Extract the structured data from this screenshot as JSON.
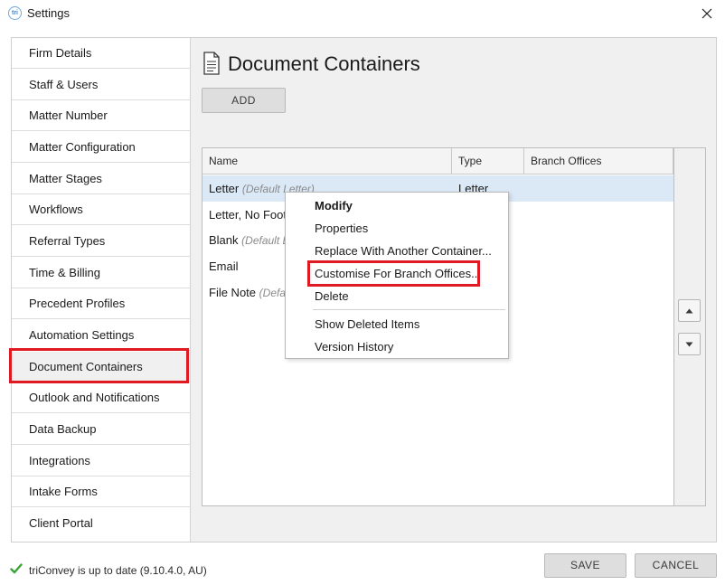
{
  "window": {
    "title": "Settings",
    "app_icon_text": "tri"
  },
  "sidebar": {
    "items": [
      {
        "label": "Firm Details"
      },
      {
        "label": "Staff & Users"
      },
      {
        "label": "Matter Number"
      },
      {
        "label": "Matter Configuration"
      },
      {
        "label": "Matter Stages"
      },
      {
        "label": "Workflows"
      },
      {
        "label": "Referral Types"
      },
      {
        "label": "Time & Billing"
      },
      {
        "label": "Precedent Profiles"
      },
      {
        "label": "Automation Settings"
      },
      {
        "label": "Document Containers",
        "selected": true
      },
      {
        "label": "Outlook and Notifications"
      },
      {
        "label": "Data Backup"
      },
      {
        "label": "Integrations"
      },
      {
        "label": "Intake Forms"
      },
      {
        "label": "Client Portal"
      }
    ]
  },
  "main": {
    "title": "Document Containers",
    "title_icon": "document-icon",
    "add_label": "ADD",
    "table": {
      "columns": [
        "Name",
        "Type",
        "Branch Offices"
      ],
      "rows": [
        {
          "name": "Letter",
          "note": "(Default Letter)",
          "type": "Letter",
          "branch": ""
        },
        {
          "name": "Letter, No Foot",
          "note": "",
          "type": "",
          "branch": ""
        },
        {
          "name": "Blank",
          "note": "(Default B",
          "type": "",
          "branch": ""
        },
        {
          "name": "Email",
          "note": "",
          "type": "",
          "branch": ""
        },
        {
          "name": "File Note",
          "note": "(Defa",
          "type": "",
          "branch": ""
        }
      ]
    }
  },
  "context_menu": {
    "modify": "Modify",
    "properties": "Properties",
    "replace": "Replace With Another Container...",
    "customise": "Customise For Branch Offices...",
    "delete": "Delete",
    "show_deleted": "Show Deleted Items",
    "version_history": "Version History"
  },
  "footer": {
    "status": "triConvey is up to date (9.10.4.0, AU)",
    "save_label": "SAVE",
    "cancel_label": "CANCEL"
  },
  "colors": {
    "highlight": "#e01a22",
    "selected_row": "#dbe8f6",
    "status_check": "#3aa335"
  }
}
